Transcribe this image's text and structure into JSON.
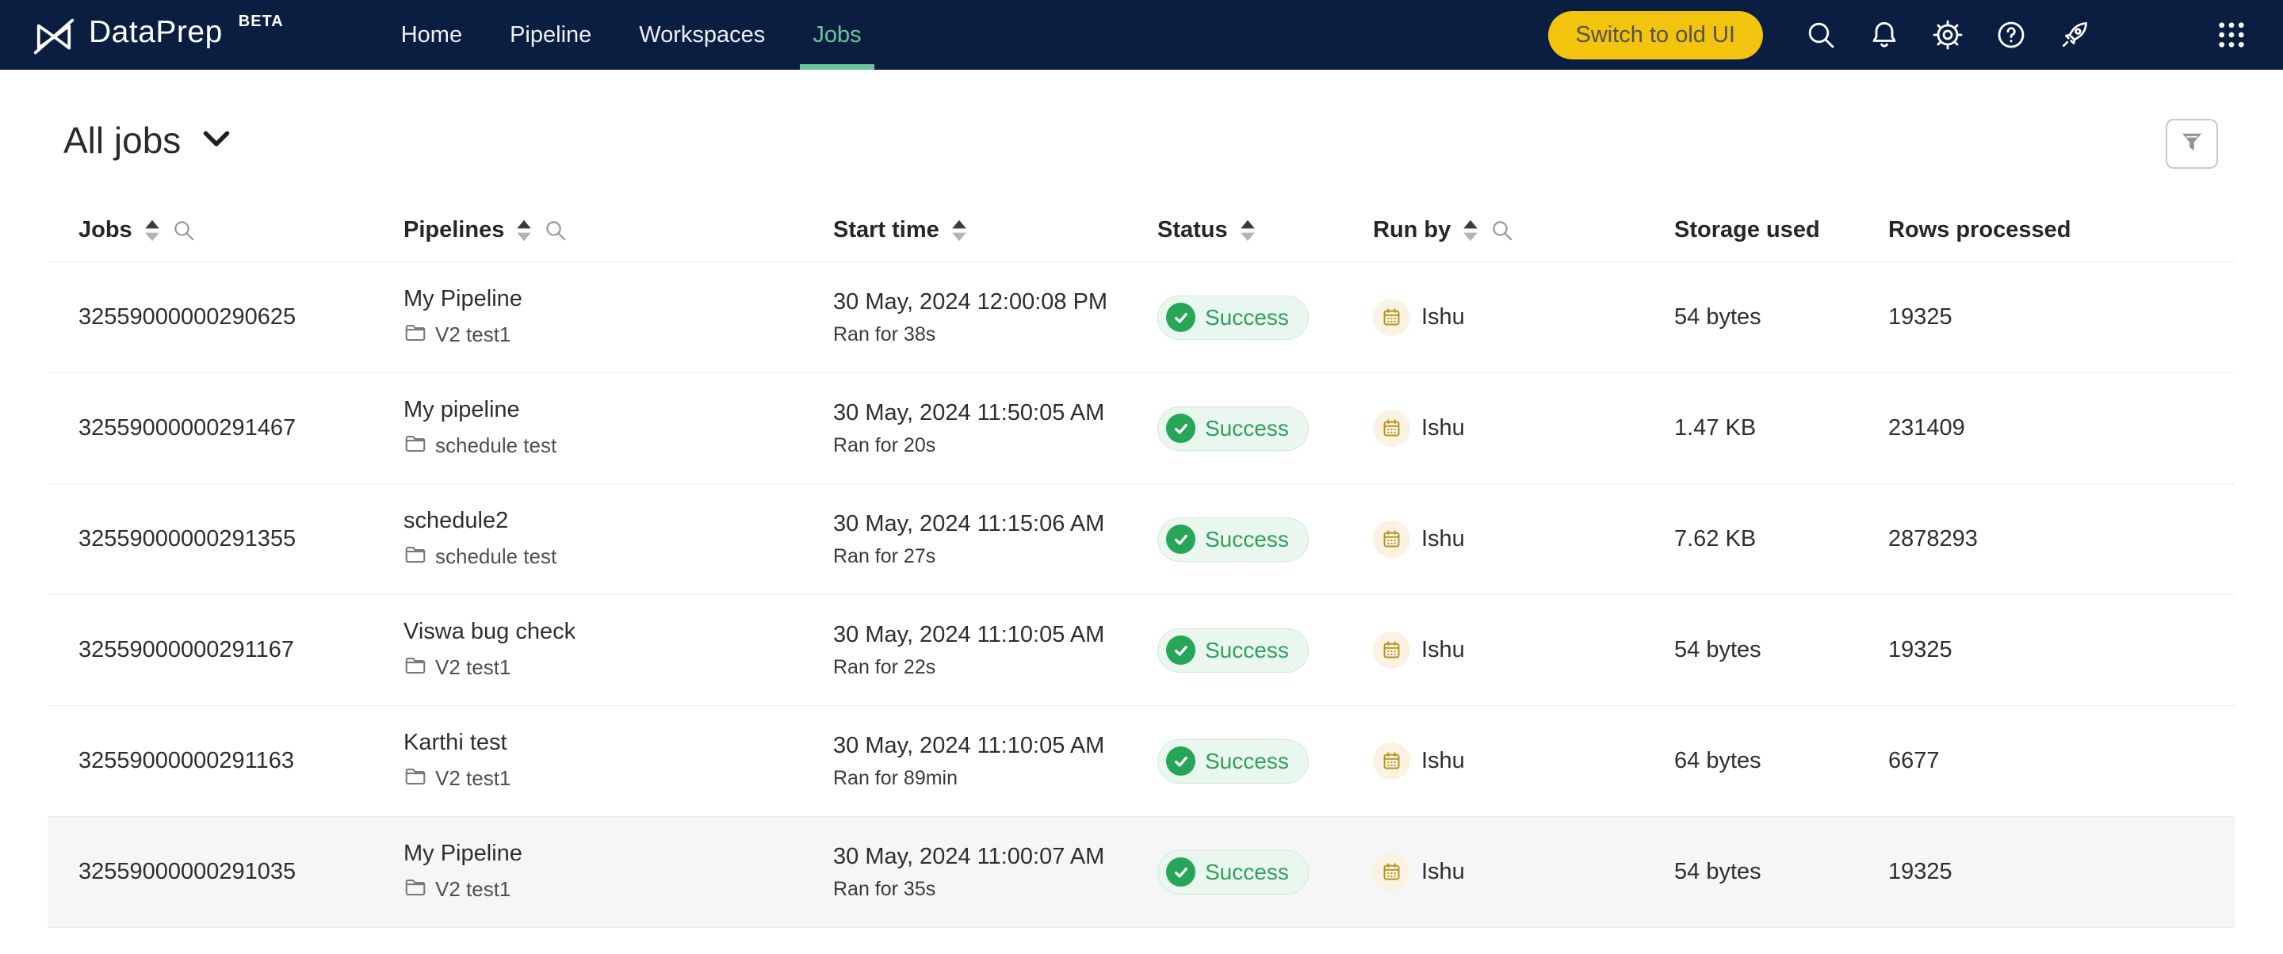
{
  "brand": {
    "name": "DataPrep",
    "beta": "BETA"
  },
  "nav": {
    "items": [
      {
        "label": "Home",
        "active": false
      },
      {
        "label": "Pipeline",
        "active": false
      },
      {
        "label": "Workspaces",
        "active": false
      },
      {
        "label": "Jobs",
        "active": true
      }
    ],
    "switch_button": "Switch to old UI"
  },
  "page": {
    "title": "All jobs"
  },
  "table": {
    "columns": [
      {
        "label": "Jobs",
        "sortable": true,
        "searchable": true
      },
      {
        "label": "Pipelines",
        "sortable": true,
        "searchable": true
      },
      {
        "label": "Start time",
        "sortable": true,
        "searchable": false
      },
      {
        "label": "Status",
        "sortable": true,
        "searchable": false
      },
      {
        "label": "Run by",
        "sortable": true,
        "searchable": true
      },
      {
        "label": "Storage used",
        "sortable": false,
        "searchable": false
      },
      {
        "label": "Rows processed",
        "sortable": false,
        "searchable": false
      }
    ],
    "rows": [
      {
        "job_id": "32559000000290625",
        "pipeline": "My Pipeline",
        "workspace": "V2 test1",
        "start_time": "30 May, 2024 12:00:08 PM",
        "duration": "Ran for 38s",
        "status": "Success",
        "run_by": "Ishu",
        "storage_used": "54 bytes",
        "rows_processed": "19325",
        "highlighted": false
      },
      {
        "job_id": "32559000000291467",
        "pipeline": "My pipeline",
        "workspace": "schedule test",
        "start_time": "30 May, 2024 11:50:05 AM",
        "duration": "Ran for 20s",
        "status": "Success",
        "run_by": "Ishu",
        "storage_used": "1.47 KB",
        "rows_processed": "231409",
        "highlighted": false
      },
      {
        "job_id": "32559000000291355",
        "pipeline": "schedule2",
        "workspace": "schedule test",
        "start_time": "30 May, 2024 11:15:06 AM",
        "duration": "Ran for 27s",
        "status": "Success",
        "run_by": "Ishu",
        "storage_used": "7.62 KB",
        "rows_processed": "2878293",
        "highlighted": false
      },
      {
        "job_id": "32559000000291167",
        "pipeline": "Viswa bug check",
        "workspace": "V2 test1",
        "start_time": "30 May, 2024 11:10:05 AM",
        "duration": "Ran for 22s",
        "status": "Success",
        "run_by": "Ishu",
        "storage_used": "54 bytes",
        "rows_processed": "19325",
        "highlighted": false
      },
      {
        "job_id": "32559000000291163",
        "pipeline": "Karthi test",
        "workspace": "V2 test1",
        "start_time": "30 May, 2024 11:10:05 AM",
        "duration": "Ran for 89min",
        "status": "Success",
        "run_by": "Ishu",
        "storage_used": "64 bytes",
        "rows_processed": "6677",
        "highlighted": false
      },
      {
        "job_id": "32559000000291035",
        "pipeline": "My Pipeline",
        "workspace": "V2 test1",
        "start_time": "30 May, 2024 11:00:07 AM",
        "duration": "Ran for 35s",
        "status": "Success",
        "run_by": "Ishu",
        "storage_used": "54 bytes",
        "rows_processed": "19325",
        "highlighted": true
      }
    ]
  },
  "colors": {
    "navbar_bg": "#0a1e42",
    "accent_green": "#6cc59a",
    "switch_yellow": "#f2c40e",
    "success_bg": "#eaf7ef",
    "success_fg": "#2f9e5c",
    "success_circle": "#27a559",
    "runby_circle": "#fbf3e1",
    "runby_icon": "#b8901e",
    "divider": "#ececec"
  }
}
